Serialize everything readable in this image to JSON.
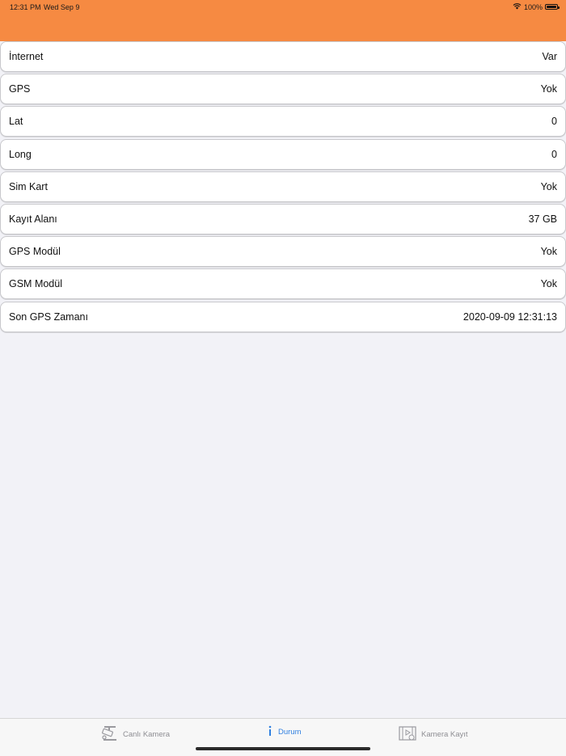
{
  "status_bar": {
    "time": "12:31 PM",
    "date": "Wed Sep 9",
    "battery": "100%",
    "wifi_icon": "wifi-icon",
    "battery_icon": "battery-icon"
  },
  "colors": {
    "header": "#f68a42",
    "background": "#f2f2f7",
    "active_tab": "#2f7fe0"
  },
  "status_rows": [
    {
      "label": "İnternet",
      "value": "Var"
    },
    {
      "label": "GPS",
      "value": "Yok"
    },
    {
      "label": "Lat",
      "value": "0"
    },
    {
      "label": "Long",
      "value": "0"
    },
    {
      "label": "Sim Kart",
      "value": "Yok"
    },
    {
      "label": "Kayıt Alanı",
      "value": "37 GB"
    },
    {
      "label": "GPS Modül",
      "value": "Yok"
    },
    {
      "label": "GSM Modül",
      "value": "Yok"
    },
    {
      "label": "Son GPS Zamanı",
      "value": "2020-09-09 12:31:13"
    }
  ],
  "tabbar": {
    "tabs": [
      {
        "label": "Canlı Kamera",
        "icon": "camera-icon",
        "active": false
      },
      {
        "label": "Durum",
        "icon": "info-icon",
        "active": true
      },
      {
        "label": "Kamera Kayıt",
        "icon": "film-icon",
        "active": false
      }
    ]
  }
}
